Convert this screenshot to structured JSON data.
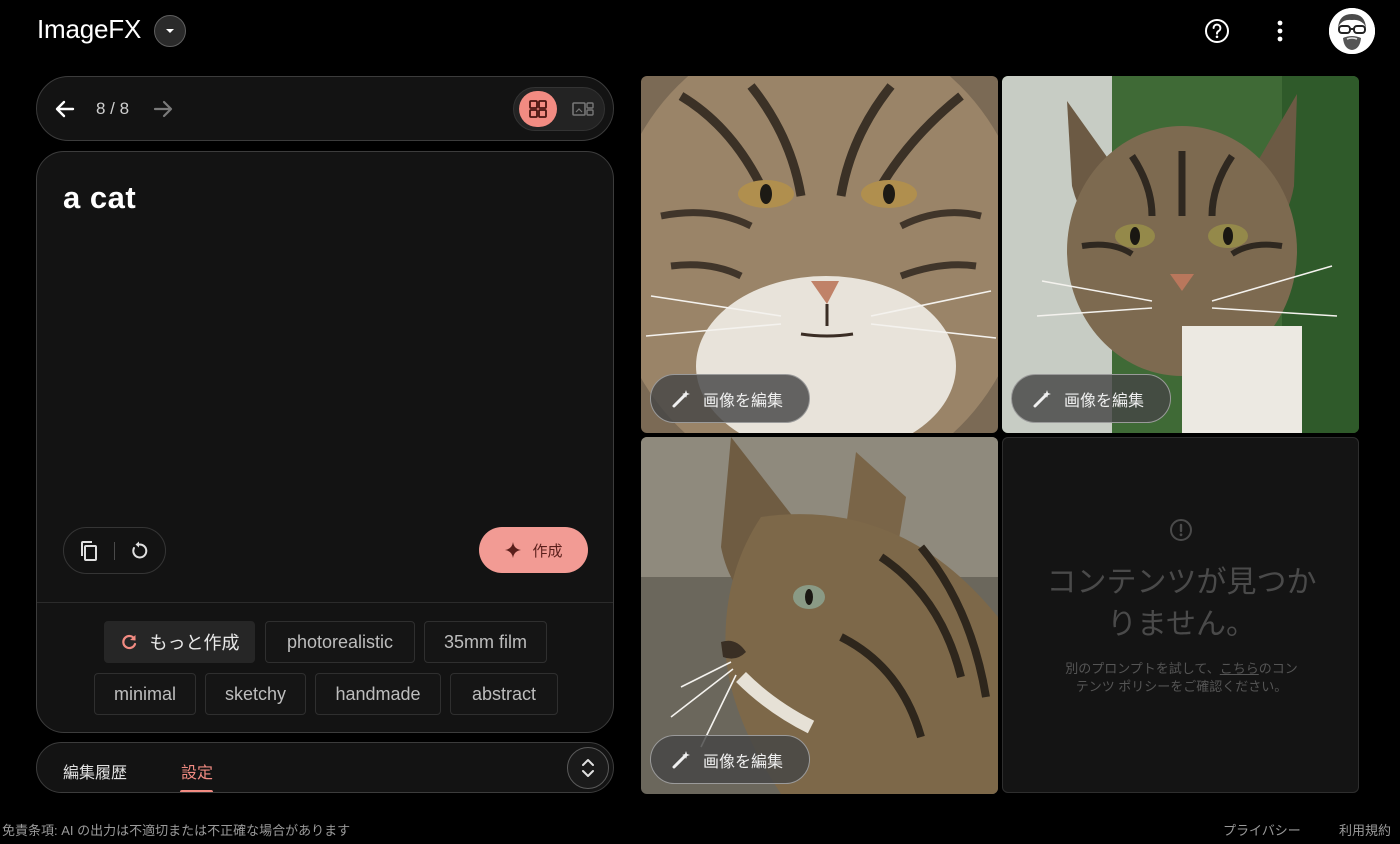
{
  "header": {
    "title": "ImageFX",
    "icons": [
      "chevron-down-icon",
      "help-icon",
      "more-vert-icon",
      "avatar"
    ]
  },
  "nav": {
    "count": "8 / 8",
    "icons": [
      "arrow-left-icon",
      "arrow-right-icon",
      "grid-view-icon",
      "list-view-icon"
    ]
  },
  "prompt": {
    "text": "a cat",
    "create_label": "作成",
    "icons": [
      "copy-icon",
      "reset-icon",
      "sparkle-icon"
    ]
  },
  "chips": {
    "more_label": "もっと作成",
    "items": [
      "photorealistic",
      "35mm film",
      "minimal",
      "sketchy",
      "handmade",
      "abstract"
    ]
  },
  "bottom_bar": {
    "history_label": "編集履歴",
    "settings_label": "設定",
    "active_tab": "設定"
  },
  "images": {
    "edit_label": "画像を編集",
    "empty": {
      "title": "コンテンツが見つかりません。",
      "desc_before": "別のプロンプトを試して、",
      "desc_link": "こちら",
      "desc_after": "のコンテンツ ポリシーをご確認ください。"
    }
  },
  "footer": {
    "disclaimer": "免責条項: AI の出力は不適切または不正確な場合があります",
    "privacy": "プライバシー",
    "terms": "利用規約"
  },
  "colors": {
    "accent": "#f28b82",
    "create_button": "#f29b94",
    "background": "#000000",
    "panel": "#131313"
  }
}
